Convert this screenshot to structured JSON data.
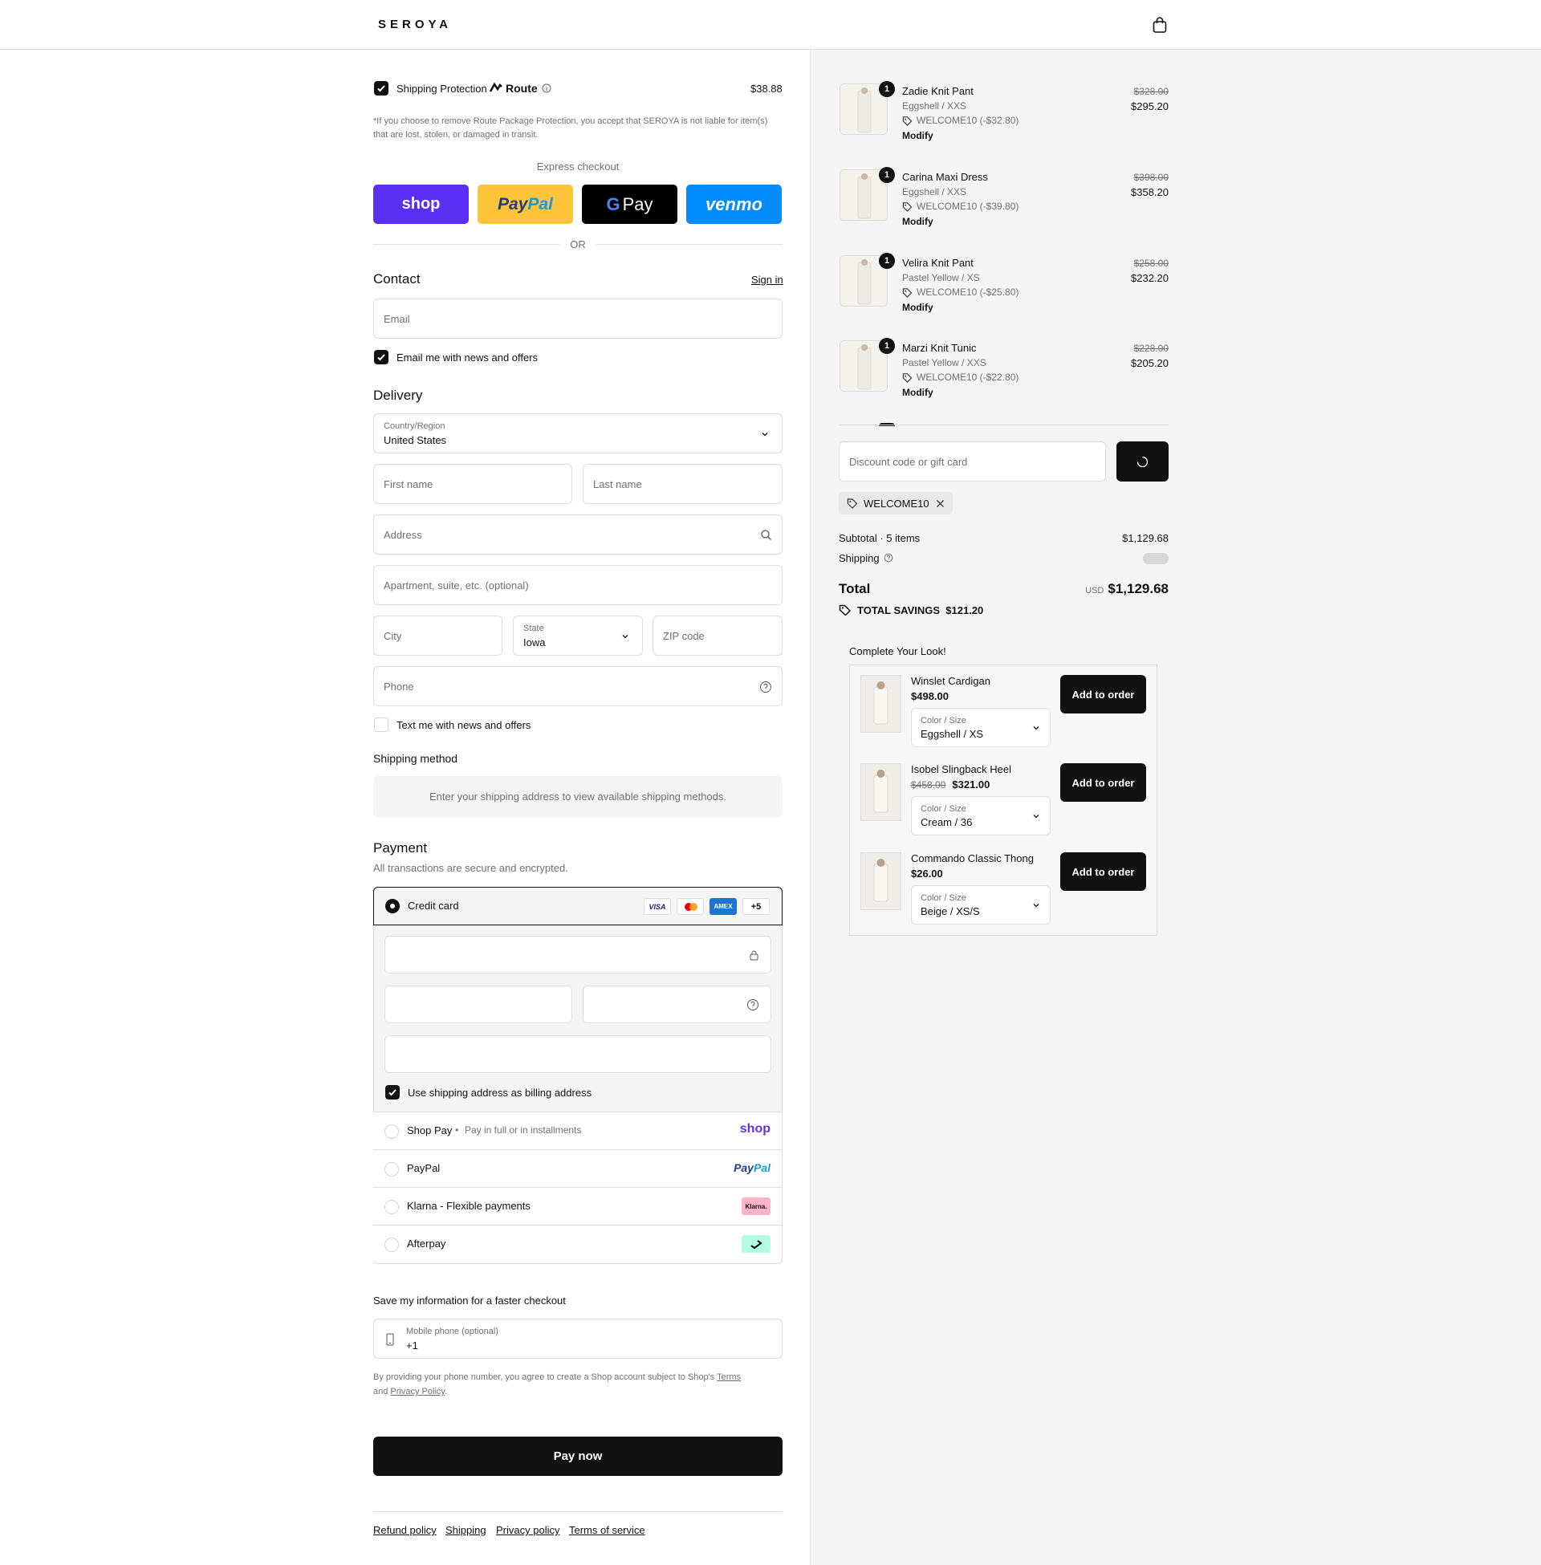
{
  "header": {
    "brand": "SEROYA"
  },
  "protection": {
    "label": "Shipping Protection",
    "brand": "Route",
    "price": "$38.88",
    "disclaimer": "*If you choose to remove Route Package Protection, you accept that SEROYA is not liable for item(s) that are lost, stolen, or damaged in transit."
  },
  "express": {
    "title": "Express checkout",
    "shop": "shop",
    "paypal_a": "Pay",
    "paypal_b": "Pal",
    "gpay": "Pay",
    "venmo": "venmo",
    "or": "OR"
  },
  "contact": {
    "title": "Contact",
    "sign_in": "Sign in",
    "email_placeholder": "Email",
    "news_label": "Email me with news and offers"
  },
  "delivery": {
    "title": "Delivery",
    "country_label": "Country/Region",
    "country_value": "United States",
    "first_name": "First name",
    "last_name": "Last name",
    "address": "Address",
    "apartment": "Apartment, suite, etc. (optional)",
    "city": "City",
    "state_label": "State",
    "state_value": "Iowa",
    "zip": "ZIP code",
    "phone": "Phone",
    "text_label": "Text me with news and offers"
  },
  "shipping_method": {
    "title": "Shipping method",
    "notice": "Enter your shipping address to view available shipping methods."
  },
  "payment": {
    "title": "Payment",
    "subtitle": "All transactions are secure and encrypted.",
    "credit_card": "Credit card",
    "more_cards": "+5",
    "visa": "VISA",
    "amex": "AMEX",
    "billing_label": "Use shipping address as billing address",
    "shop_pay": "Shop Pay",
    "shop_pay_note": "Pay in full or in installments",
    "shop_logo": "shop",
    "paypal": "PayPal",
    "paypal_logo_a": "Pay",
    "paypal_logo_b": "Pal",
    "klarna": "Klarna - Flexible payments",
    "klarna_logo": "Klarna.",
    "afterpay": "Afterpay"
  },
  "save": {
    "title": "Save my information for a faster checkout",
    "phone_label": "Mobile phone (optional)",
    "phone_value": "+1",
    "terms_a": "By providing your phone number, you agree to create a Shop account subject to Shop's ",
    "terms_link": "Terms",
    "terms_b": "and ",
    "privacy_link": "Privacy Policy",
    "terms_end": "."
  },
  "pay_now": "Pay now",
  "footer_links": [
    "Refund policy",
    "Shipping",
    "Privacy policy",
    "Terms of service"
  ],
  "cart": {
    "items": [
      {
        "qty": "1",
        "name": "Zadie Knit Pant",
        "variant": "Eggshell / XXS",
        "discount": "WELCOME10 (-$32.80)",
        "modify": "Modify",
        "original": "$328.00",
        "price": "$295.20"
      },
      {
        "qty": "1",
        "name": "Carina Maxi Dress",
        "variant": "Eggshell / XXS",
        "discount": "WELCOME10 (-$39.80)",
        "modify": "Modify",
        "original": "$398.00",
        "price": "$358.20"
      },
      {
        "qty": "1",
        "name": "Velira Knit Pant",
        "variant": "Pastel Yellow / XS",
        "discount": "WELCOME10 (-$25.80)",
        "modify": "Modify",
        "original": "$258.00",
        "price": "$232.20"
      },
      {
        "qty": "1",
        "name": "Marzi Knit Tunic",
        "variant": "Pastel Yellow / XXS",
        "discount": "WELCOME10 (-$22.80)",
        "modify": "Modify",
        "original": "$228.00",
        "price": "$205.20"
      }
    ],
    "discount_placeholder": "Discount code or gift card",
    "applied_code": "WELCOME10",
    "subtotal_label": "Subtotal · 5 items",
    "subtotal": "$1,129.68",
    "shipping_label": "Shipping",
    "total_label": "Total",
    "currency": "USD",
    "total": "$1,129.68",
    "savings_label": "TOTAL SAVINGS",
    "savings": "$121.20"
  },
  "upsell": {
    "title": "Complete Your Look!",
    "items": [
      {
        "name": "Winslet Cardigan",
        "original": "",
        "price": "$498.00",
        "option_label": "Color / Size",
        "option_value": "Eggshell / XS",
        "button": "Add to order"
      },
      {
        "name": "Isobel Slingback Heel",
        "original": "$458.00",
        "price": "$321.00",
        "option_label": "Color / Size",
        "option_value": "Cream / 36",
        "button": "Add to order"
      },
      {
        "name": "Commando Classic Thong",
        "original": "",
        "price": "$26.00",
        "option_label": "Color / Size",
        "option_value": "Beige / XS/S",
        "button": "Add to order"
      }
    ]
  },
  "colors": {
    "shop": "#5a31f4",
    "paypal_bg": "#ffc439",
    "venmo": "#008cff",
    "klarna": "#ffb3c7",
    "afterpay": "#b2fce4"
  }
}
